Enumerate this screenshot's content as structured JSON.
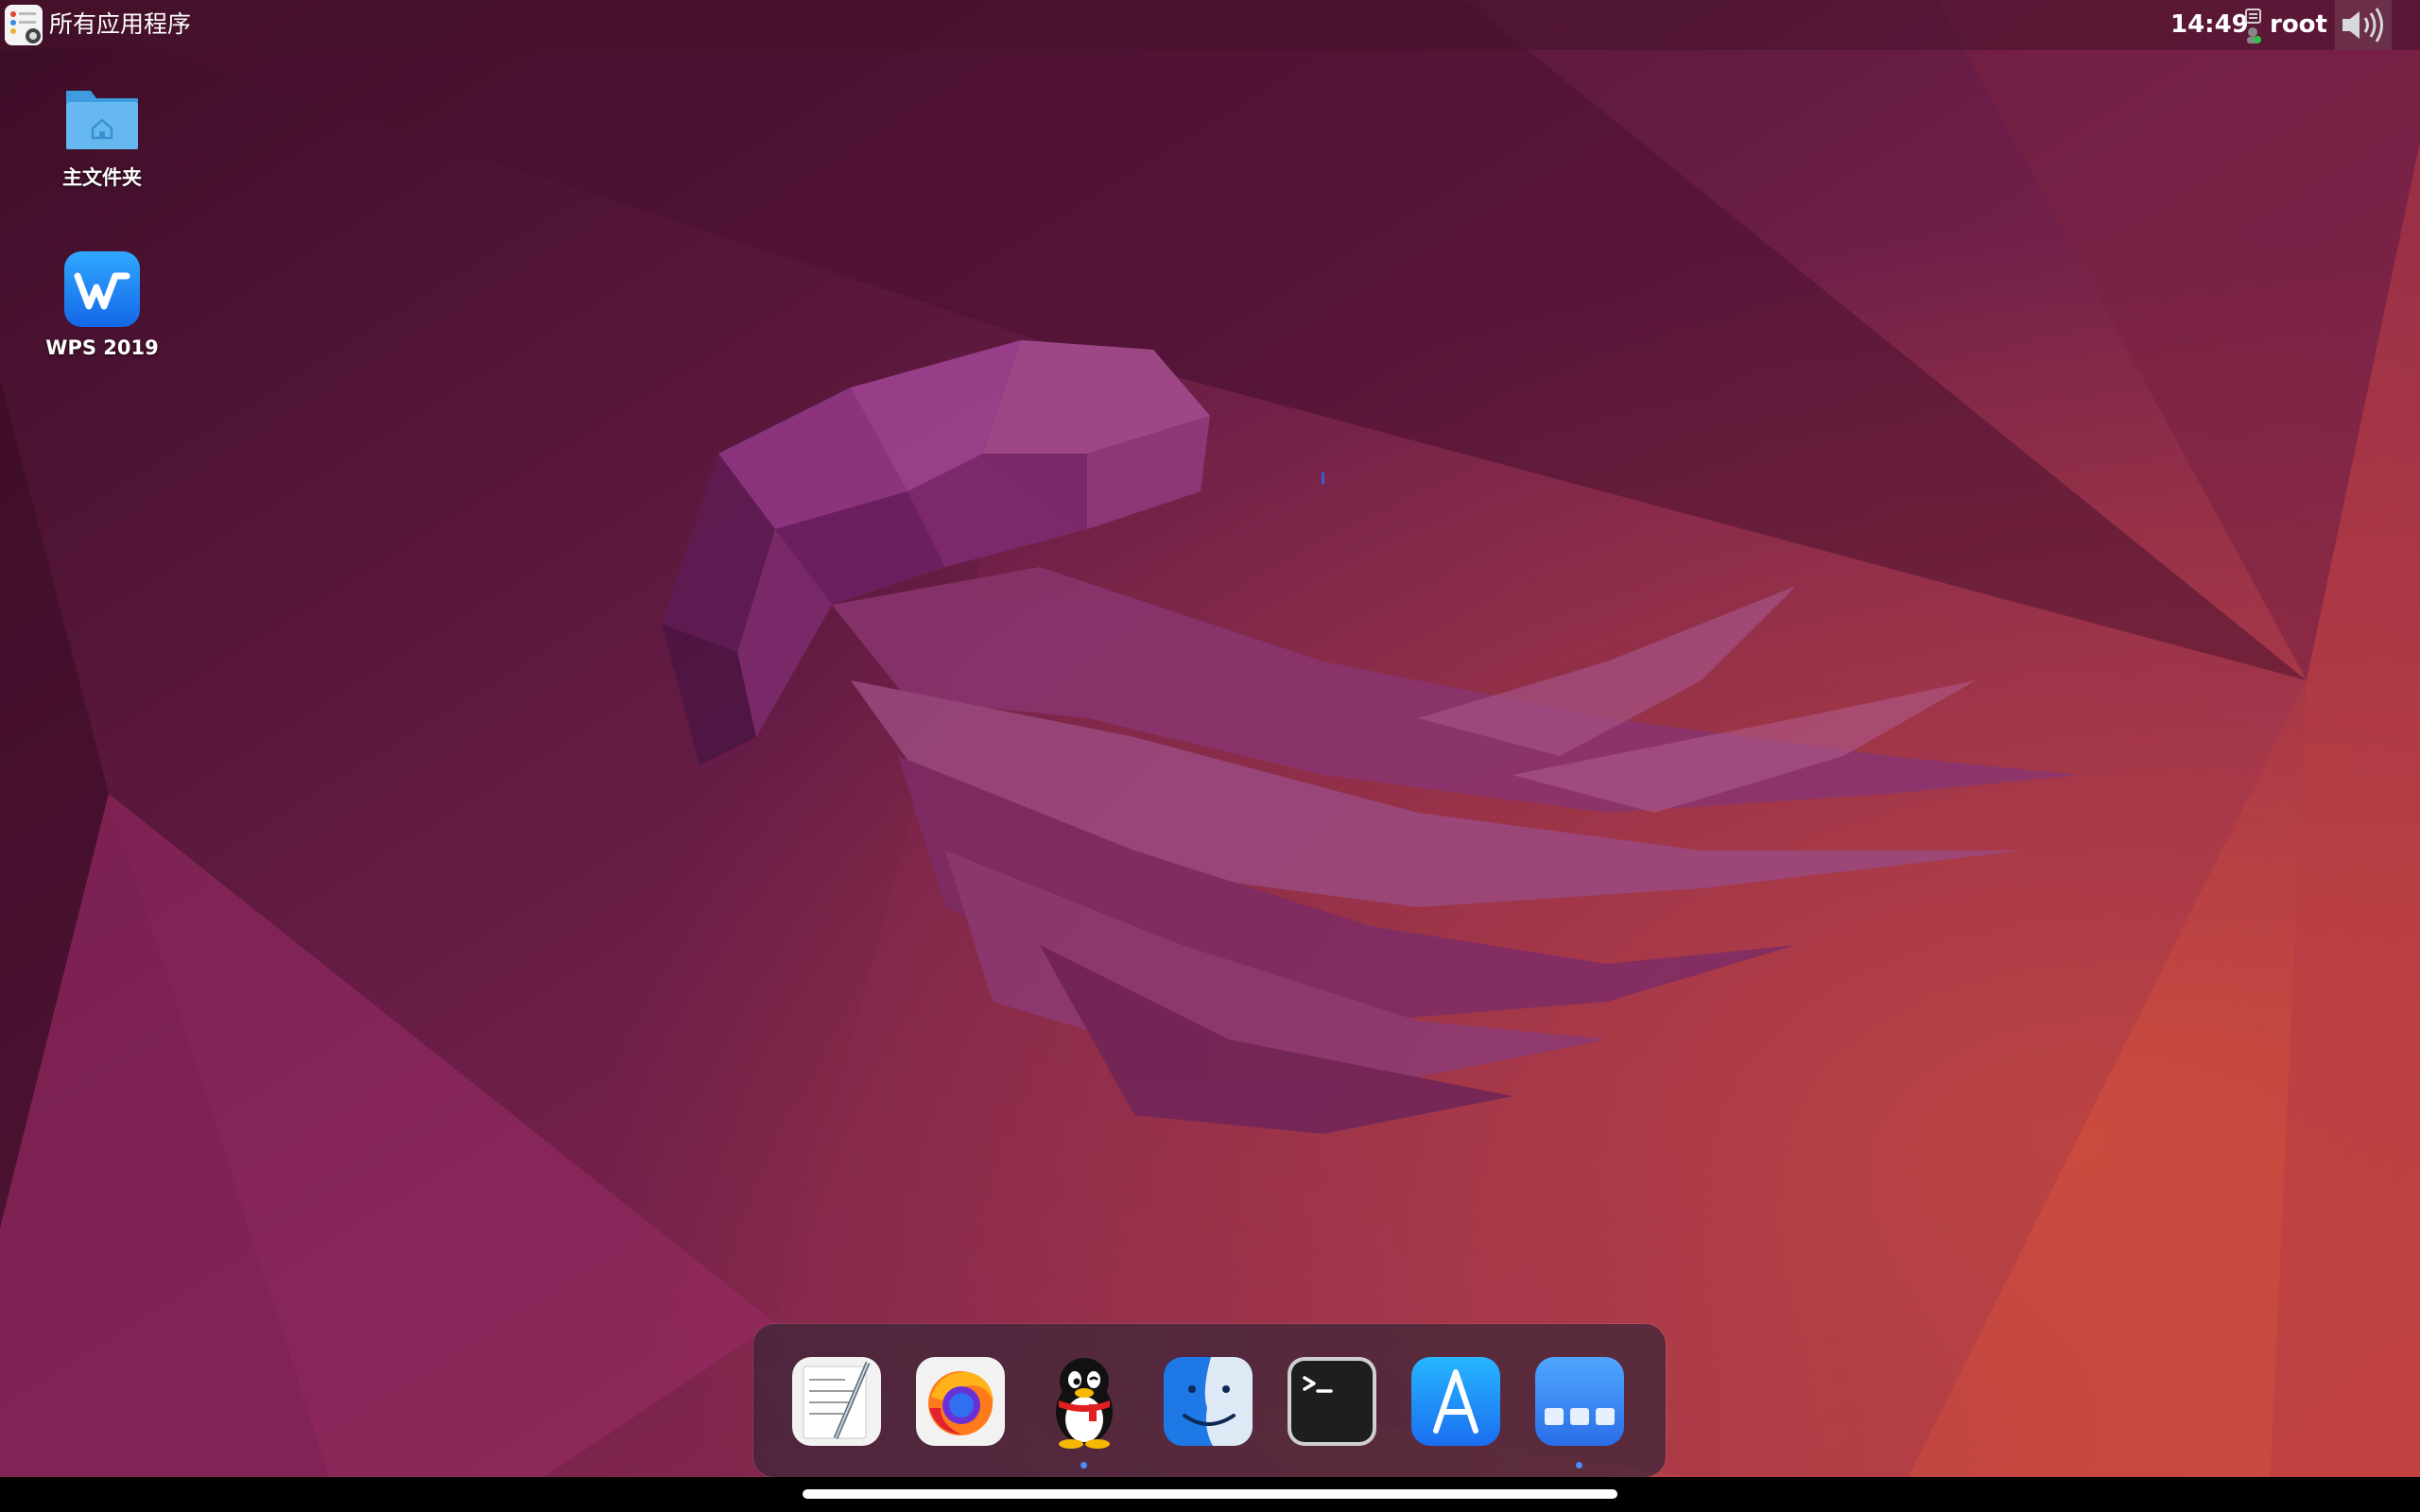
{
  "topbar": {
    "app_menu_label": "所有应用程序",
    "clock": "14:49",
    "user": "root",
    "icons": {
      "app_menu": "launcher-icon",
      "user": "user-icon",
      "volume": "volume-icon"
    }
  },
  "desktop": {
    "items": [
      {
        "label": "主文件夹",
        "icon": "home-folder-icon"
      },
      {
        "label": "WPS 2019",
        "icon": "wps-icon"
      }
    ]
  },
  "dock": {
    "items": [
      {
        "name": "TextEdit",
        "icon": "text-editor-icon",
        "running": false
      },
      {
        "name": "Firefox",
        "icon": "firefox-icon",
        "running": false
      },
      {
        "name": "QQ",
        "icon": "qq-penguin-icon",
        "running": true
      },
      {
        "name": "Finder",
        "icon": "finder-icon",
        "running": false
      },
      {
        "name": "Terminal",
        "icon": "terminal-icon",
        "running": false
      },
      {
        "name": "App Store",
        "icon": "app-store-icon",
        "running": false
      },
      {
        "name": "Launchpad",
        "icon": "launchpad-icon",
        "running": true
      }
    ]
  },
  "colors": {
    "wallpaper_base": "#6a1e45",
    "wallpaper_accent": "#c8404a",
    "dock_bg": "#3a2638",
    "accent_blue": "#4b8cff"
  }
}
